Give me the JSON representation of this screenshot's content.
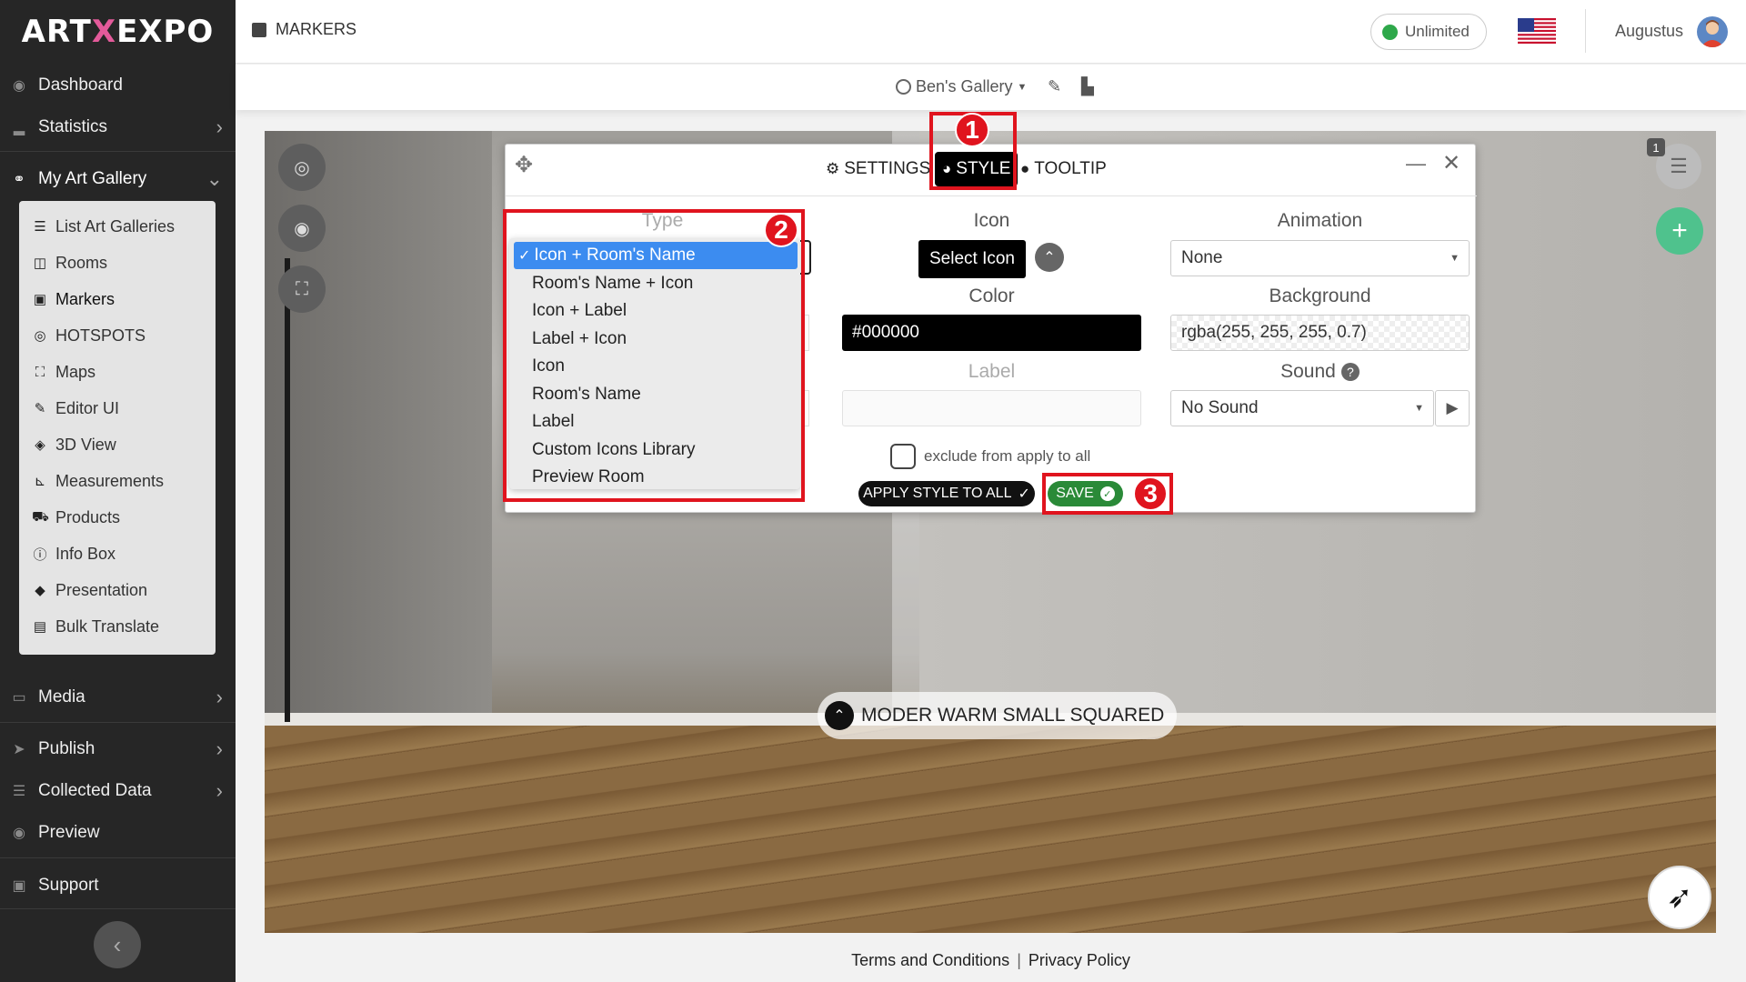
{
  "app": {
    "logo_prefix": "ART",
    "logo_x": "X",
    "logo_suffix": "EXPO"
  },
  "sidebar": {
    "items": [
      {
        "label": "Dashboard",
        "icon": "dashboard-icon"
      },
      {
        "label": "Statistics",
        "icon": "chart-icon"
      },
      {
        "label": "My Art Gallery",
        "icon": "gallery-icon"
      },
      {
        "label": "Media",
        "icon": "monitor-icon"
      },
      {
        "label": "Publish",
        "icon": "send-icon"
      },
      {
        "label": "Collected Data",
        "icon": "database-icon"
      },
      {
        "label": "Preview",
        "icon": "eye-icon"
      },
      {
        "label": "Support",
        "icon": "support-icon"
      }
    ],
    "submenu": [
      {
        "label": "List Art Galleries",
        "icon": "list-icon"
      },
      {
        "label": "Rooms",
        "icon": "rooms-icon"
      },
      {
        "label": "Markers",
        "icon": "marker-icon"
      },
      {
        "label": "HOTSPOTS",
        "icon": "hotspot-icon"
      },
      {
        "label": "Maps",
        "icon": "map-icon"
      },
      {
        "label": "Editor UI",
        "icon": "editor-icon"
      },
      {
        "label": "3D View",
        "icon": "cube-icon"
      },
      {
        "label": "Measurements",
        "icon": "ruler-icon"
      },
      {
        "label": "Products",
        "icon": "cart-icon"
      },
      {
        "label": "Info Box",
        "icon": "info-icon"
      },
      {
        "label": "Presentation",
        "icon": "presentation-icon"
      },
      {
        "label": "Bulk Translate",
        "icon": "translate-icon"
      }
    ]
  },
  "header": {
    "page_title": "MARKERS",
    "plan": "Unlimited",
    "username": "Augustus"
  },
  "gallerybar": {
    "gallery": "Ben's Gallery"
  },
  "modal": {
    "tabs": [
      "SETTINGS",
      "STYLE",
      "TOOLTIP"
    ],
    "active_tab": "STYLE",
    "fields": {
      "type_label": "Type",
      "icon_label": "Icon",
      "animation_label": "Animation",
      "color_label": "Color",
      "background_label": "Background",
      "label_label": "Label",
      "sound_label": "Sound"
    },
    "select_icon_button": "Select Icon",
    "animation_value": "None",
    "color_value": "#000000",
    "background_value": "rgba(255, 255, 255, 0.7)",
    "label_value": "",
    "sound_value": "No Sound",
    "exclude_text": "exclude from apply to all",
    "apply_button": "APPLY STYLE TO ALL",
    "save_button": "SAVE"
  },
  "type_dropdown": {
    "selected": "Icon + Room's Name",
    "options": [
      "Icon + Room's Name",
      "Room's Name + Icon",
      "Icon + Label",
      "Label + Icon",
      "Icon",
      "Room's Name",
      "Label",
      "Custom Icons Library",
      "Preview Room"
    ]
  },
  "viewer": {
    "marker_label": "MODER WARM SMALL SQUARED",
    "list_count": "1"
  },
  "annotations": [
    "1",
    "2",
    "3"
  ],
  "footer": {
    "terms": "Terms and Conditions",
    "separator": "|",
    "privacy": "Privacy Policy"
  },
  "colors": {
    "sidebar_bg": "#262626",
    "active_tab_bg": "#000000",
    "dropdown_highlight": "#3c8cf0",
    "save_green": "#2a8a38",
    "annotation_red": "#e0141e",
    "add_button_green": "#4fc28d"
  }
}
